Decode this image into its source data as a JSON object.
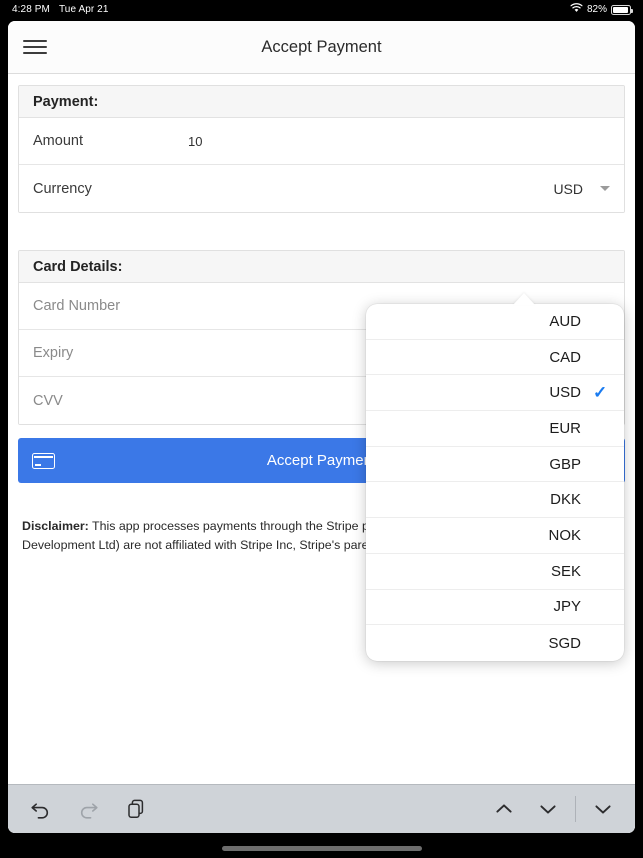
{
  "statusbar": {
    "time": "4:28 PM",
    "date": "Tue Apr 21",
    "battery_percent": "82%",
    "wifi_icon": "wifi-icon",
    "battery_icon": "battery-icon"
  },
  "navbar": {
    "menu_icon": "hamburger-menu-icon",
    "title": "Accept Payment"
  },
  "payment_section": {
    "header": "Payment:",
    "rows": [
      {
        "label": "Amount",
        "value": "10"
      },
      {
        "label": "Currency",
        "value": "USD"
      }
    ]
  },
  "card_section": {
    "header": "Card Details:",
    "rows": [
      {
        "label": "Card Number",
        "value": ""
      },
      {
        "label": "Expiry",
        "value": ""
      },
      {
        "label": "CVV",
        "value": ""
      }
    ]
  },
  "accept_button": {
    "label": "Accept Payment",
    "icon": "credit-card-icon",
    "color": "#3b78e7"
  },
  "disclaimer": {
    "bold_prefix": "Disclaimer:",
    "text": " This app processes payments through the Stripe payment gateway. We (Infinite Loop Development Ltd) are not affiliated with Stripe Inc, Stripe's parent company or any of its subsidiaries."
  },
  "currency_popover": {
    "selected": "USD",
    "check_glyph": "✓",
    "items": [
      {
        "label": "AUD",
        "selected": false
      },
      {
        "label": "CAD",
        "selected": false
      },
      {
        "label": "USD",
        "selected": true
      },
      {
        "label": "EUR",
        "selected": false
      },
      {
        "label": "GBP",
        "selected": false
      },
      {
        "label": "DKK",
        "selected": false
      },
      {
        "label": "NOK",
        "selected": false
      },
      {
        "label": "SEK",
        "selected": false
      },
      {
        "label": "JPY",
        "selected": false
      },
      {
        "label": "SGD",
        "selected": false
      }
    ]
  },
  "accessory_toolbar": {
    "undo_icon": "undo-arrow-icon",
    "redo_icon": "redo-arrow-icon",
    "paste_icon": "paste-documents-icon",
    "prev_icon": "chevron-up-icon",
    "next_icon": "chevron-down-icon",
    "dismiss_icon": "chevron-down-icon"
  }
}
